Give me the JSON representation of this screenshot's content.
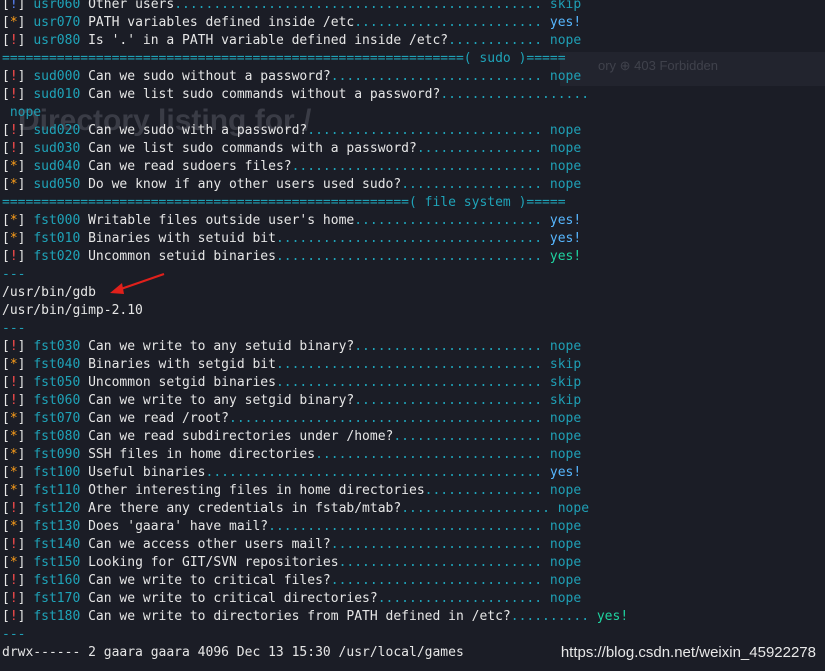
{
  "background_overlay": {
    "heading": "Directory listing for /",
    "nav": "ory  ⊕ 403 Forbidden"
  },
  "lines": [
    {
      "type": "check",
      "marker": "!",
      "level": "info",
      "code": "usr060",
      "question": "Other users",
      "dots": "...............................................",
      "result": "skip",
      "result_style": "skip"
    },
    {
      "type": "check",
      "marker": "*",
      "level": "warn",
      "code": "usr070",
      "question": "PATH variables defined inside /etc",
      "dots": "........................",
      "result": "yes!",
      "result_style": "yes"
    },
    {
      "type": "check",
      "marker": "!",
      "level": "crit",
      "code": "usr080",
      "question": "Is '.' in a PATH variable defined inside /etc?",
      "dots": "............",
      "result": "nope",
      "result_style": "nope"
    },
    {
      "type": "separator",
      "left": "===========================================================",
      "label": "( sudo )",
      "right": "====="
    },
    {
      "type": "check",
      "marker": "!",
      "level": "crit",
      "code": "sud000",
      "question": "Can we sudo without a password?",
      "dots": "...........................",
      "result": "nope",
      "result_style": "nope"
    },
    {
      "type": "check",
      "marker": "!",
      "level": "crit",
      "code": "sud010",
      "question": "Can we list sudo commands without a password?",
      "dots": "...................",
      "result": "",
      "result_style": "nope"
    },
    {
      "type": "plain",
      "text": " nope",
      "style": "nope"
    },
    {
      "type": "check",
      "marker": "!",
      "level": "crit",
      "code": "sud020",
      "question": "Can we sudo with a password?",
      "dots": "..............................",
      "result": "nope",
      "result_style": "nope"
    },
    {
      "type": "check",
      "marker": "!",
      "level": "crit",
      "code": "sud030",
      "question": "Can we list sudo commands with a password?",
      "dots": "................",
      "result": "nope",
      "result_style": "nope"
    },
    {
      "type": "check",
      "marker": "*",
      "level": "warn",
      "code": "sud040",
      "question": "Can we read sudoers files?",
      "dots": "................................",
      "result": "nope",
      "result_style": "nope"
    },
    {
      "type": "check",
      "marker": "*",
      "level": "warn",
      "code": "sud050",
      "question": "Do we know if any other users used sudo?",
      "dots": "..................",
      "result": "nope",
      "result_style": "nope"
    },
    {
      "type": "separator",
      "left": "====================================================",
      "label": "( file system )",
      "right": "====="
    },
    {
      "type": "check",
      "marker": "*",
      "level": "warn",
      "code": "fst000",
      "question": "Writable files outside user's home",
      "dots": "........................",
      "result": "yes!",
      "result_style": "yes"
    },
    {
      "type": "check",
      "marker": "*",
      "level": "warn",
      "code": "fst010",
      "question": "Binaries with setuid bit",
      "dots": "..................................",
      "result": "yes!",
      "result_style": "yes"
    },
    {
      "type": "check",
      "marker": "!",
      "level": "crit",
      "code": "fst020",
      "question": "Uncommon setuid binaries",
      "dots": "..................................",
      "result": "yes!",
      "result_style": "yes-strong"
    },
    {
      "type": "plain",
      "text": "---",
      "style": "dash"
    },
    {
      "type": "plain",
      "text": "/usr/bin/gdb",
      "style": "plain",
      "name": "gdb-path"
    },
    {
      "type": "plain",
      "text": "/usr/bin/gimp-2.10",
      "style": "plain"
    },
    {
      "type": "plain",
      "text": "---",
      "style": "dash"
    },
    {
      "type": "check",
      "marker": "!",
      "level": "crit",
      "code": "fst030",
      "question": "Can we write to any setuid binary?",
      "dots": "........................",
      "result": "nope",
      "result_style": "nope"
    },
    {
      "type": "check",
      "marker": "*",
      "level": "warn",
      "code": "fst040",
      "question": "Binaries with setgid bit",
      "dots": "..................................",
      "result": "skip",
      "result_style": "skip"
    },
    {
      "type": "check",
      "marker": "!",
      "level": "crit",
      "code": "fst050",
      "question": "Uncommon setgid binaries",
      "dots": "..................................",
      "result": "skip",
      "result_style": "skip"
    },
    {
      "type": "check",
      "marker": "!",
      "level": "crit",
      "code": "fst060",
      "question": "Can we write to any setgid binary?",
      "dots": "........................",
      "result": "skip",
      "result_style": "skip"
    },
    {
      "type": "check",
      "marker": "*",
      "level": "warn",
      "code": "fst070",
      "question": "Can we read /root?",
      "dots": "........................................",
      "result": "nope",
      "result_style": "nope"
    },
    {
      "type": "check",
      "marker": "*",
      "level": "warn",
      "code": "fst080",
      "question": "Can we read subdirectories under /home?",
      "dots": "...................",
      "result": "nope",
      "result_style": "nope"
    },
    {
      "type": "check",
      "marker": "*",
      "level": "warn",
      "code": "fst090",
      "question": "SSH files in home directories",
      "dots": ".............................",
      "result": "nope",
      "result_style": "nope"
    },
    {
      "type": "check",
      "marker": "*",
      "level": "warn",
      "code": "fst100",
      "question": "Useful binaries",
      "dots": "...........................................",
      "result": "yes!",
      "result_style": "yes"
    },
    {
      "type": "check",
      "marker": "*",
      "level": "warn",
      "code": "fst110",
      "question": "Other interesting files in home directories",
      "dots": "...............",
      "result": "nope",
      "result_style": "nope"
    },
    {
      "type": "check",
      "marker": "!",
      "level": "crit",
      "code": "fst120",
      "question": "Are there any credentials in fstab/mtab?",
      "dots": "...................",
      "result": "nope",
      "result_style": "nope"
    },
    {
      "type": "check",
      "marker": "*",
      "level": "warn",
      "code": "fst130",
      "question": "Does 'gaara' have mail?",
      "dots": "...................................",
      "result": "nope",
      "result_style": "nope"
    },
    {
      "type": "check",
      "marker": "!",
      "level": "crit",
      "code": "fst140",
      "question": "Can we access other users mail?",
      "dots": "...........................",
      "result": "nope",
      "result_style": "nope"
    },
    {
      "type": "check",
      "marker": "*",
      "level": "warn",
      "code": "fst150",
      "question": "Looking for GIT/SVN repositories",
      "dots": "..........................",
      "result": "nope",
      "result_style": "nope"
    },
    {
      "type": "check",
      "marker": "!",
      "level": "crit",
      "code": "fst160",
      "question": "Can we write to critical files?",
      "dots": "...........................",
      "result": "nope",
      "result_style": "nope"
    },
    {
      "type": "check",
      "marker": "!",
      "level": "crit",
      "code": "fst170",
      "question": "Can we write to critical directories?",
      "dots": ".....................",
      "result": "nope",
      "result_style": "nope"
    },
    {
      "type": "check",
      "marker": "!",
      "level": "crit",
      "code": "fst180",
      "question": "Can we write to directories from PATH defined in /etc?",
      "dots": "..........",
      "result": "yes!",
      "result_style": "yes-strong"
    },
    {
      "type": "plain",
      "text": "---",
      "style": "dash"
    },
    {
      "type": "plain",
      "text": "drwx------ 2 gaara gaara 4096 Dec 13 15:30 /usr/local/games",
      "style": "plain"
    }
  ],
  "watermark": "https://blog.csdn.net/weixin_45922278",
  "colors": {
    "background": "#1b1d26",
    "critical_marker": "#ff4d4d",
    "warning_marker": "#ff9f1a",
    "info_marker": "#5a86ff",
    "code": "#1fa3b8",
    "yes": "#57b7ff",
    "yes_strong": "#1fd3a0",
    "annotation_arrow": "#e0201b"
  },
  "icons": {
    "annotation": "red-arrow-icon"
  }
}
